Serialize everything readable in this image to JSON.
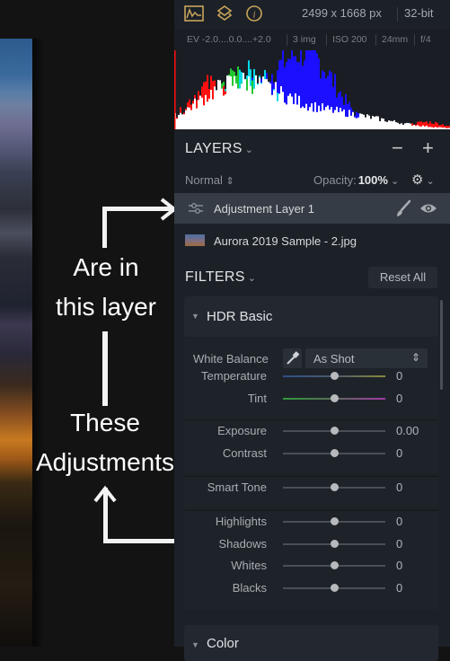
{
  "annotations": {
    "upper_label_line1": "Are in",
    "upper_label_line2": "this layer",
    "lower_label_line1": "These",
    "lower_label_line2": "Adjustments"
  },
  "topbar": {
    "icons": [
      "histogram-icon",
      "layers-icon",
      "info-icon"
    ],
    "accent_color": "#c8a45a",
    "dimensions": "2499 x 1668 px",
    "bit_depth": "32-bit"
  },
  "exif": {
    "ev": "EV  -2.0....0.0....+2.0",
    "images": "3 img",
    "iso": "ISO 200",
    "focal": "24mm",
    "aperture": "f/4"
  },
  "layers": {
    "title": "LAYERS",
    "minus_label": "−",
    "plus_label": "+",
    "blend_mode": "Normal",
    "opacity_label": "Opacity:",
    "opacity_value": "100%",
    "items": [
      {
        "name": "Adjustment Layer 1",
        "type": "adjustment",
        "active": true
      },
      {
        "name": "Aurora 2019 Sample - 2.jpg",
        "type": "image",
        "active": false
      }
    ]
  },
  "filters": {
    "title": "FILTERS",
    "reset_label": "Reset All",
    "hdr_basic": {
      "title": "HDR Basic",
      "white_balance_label": "White Balance",
      "white_balance_value": "As Shot",
      "groups": [
        [
          {
            "label": "Temperature",
            "value": "0",
            "position": 0.5,
            "track": "temperature"
          },
          {
            "label": "Tint",
            "value": "0",
            "position": 0.5,
            "track": "tint"
          }
        ],
        [
          {
            "label": "Exposure",
            "value": "0.00",
            "position": 0.5,
            "track": "plain"
          },
          {
            "label": "Contrast",
            "value": "0",
            "position": 0.5,
            "track": "plain"
          }
        ],
        [
          {
            "label": "Smart Tone",
            "value": "0",
            "position": 0.5,
            "track": "plain"
          }
        ],
        [
          {
            "label": "Highlights",
            "value": "0",
            "position": 0.5,
            "track": "plain"
          },
          {
            "label": "Shadows",
            "value": "0",
            "position": 0.5,
            "track": "plain"
          },
          {
            "label": "Whites",
            "value": "0",
            "position": 0.5,
            "track": "plain"
          },
          {
            "label": "Blacks",
            "value": "0",
            "position": 0.5,
            "track": "plain"
          }
        ]
      ]
    },
    "color": {
      "title": "Color"
    }
  }
}
